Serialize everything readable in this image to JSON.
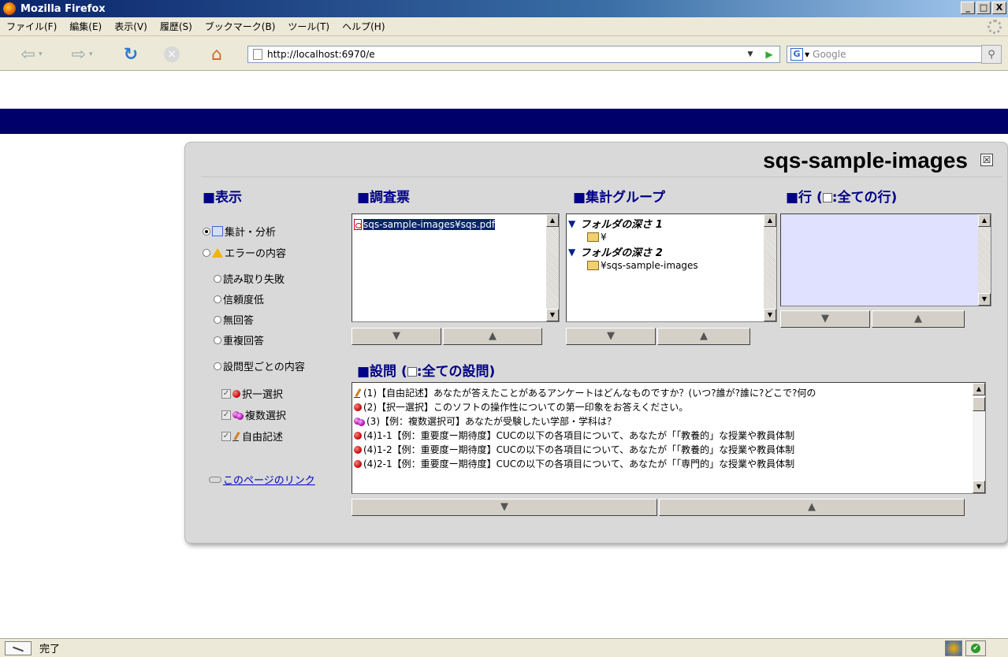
{
  "window": {
    "title": "Mozilla Firefox",
    "buttons": [
      "_",
      "□",
      "X"
    ]
  },
  "menu": [
    "ファイル(F)",
    "編集(E)",
    "表示(V)",
    "履歴(S)",
    "ブックマーク(B)",
    "ツール(T)",
    "ヘルプ(H)"
  ],
  "toolbar": {
    "url": "http://localhost:6970/e",
    "search_placeholder": "Google",
    "search_engine_letter": "G"
  },
  "panel": {
    "title": "sqs-sample-images",
    "close_label": "☒",
    "display": {
      "heading": "■表示",
      "options": {
        "aggregate": "集計・分析",
        "errors": "エラーの内容",
        "read_fail": "読み取り失敗",
        "low_conf": "信頼度低",
        "no_answer": "無回答",
        "dup_answer": "重複回答",
        "by_type": "設問型ごとの内容",
        "single": "択一選択",
        "multi": "複数選択",
        "free": "自由記述",
        "check_mark": "✓"
      },
      "link_text": "このページのリンク"
    },
    "survey": {
      "heading": "■調査票",
      "items": [
        "sqs-sample-images¥sqs.pdf"
      ]
    },
    "groups": {
      "heading": "■集計グループ",
      "depth1": "フォルダの深さ 1",
      "depth1_item": "¥",
      "depth2": "フォルダの深さ 2",
      "depth2_item": "¥sqs-sample-images",
      "triangle": "▼"
    },
    "rows": {
      "heading_prefix": "■行 (",
      "heading_suffix": ":全ての行)"
    },
    "questions": {
      "heading_prefix": "■設問 (",
      "heading_suffix": ":全ての設問)",
      "items": [
        {
          "type": "free",
          "text": "(1)【自由記述】あなたが答えたことがあるアンケートはどんなものですか？(いつ?誰が?誰に?どこで?何の"
        },
        {
          "type": "single",
          "text": "(2)【択一選択】このソフトの操作性についての第一印象をお答えください。"
        },
        {
          "type": "multi",
          "text": "(3)【例：複数選択可】あなたが受験したい学部・学科は？"
        },
        {
          "type": "single",
          "text": "(4)1-1【例：重要度ー期待度】CUCの以下の各項目について、あなたが「「教養的」な授業や教員体制"
        },
        {
          "type": "single",
          "text": "(4)1-2【例：重要度ー期待度】CUCの以下の各項目について、あなたが「「教養的」な授業や教員体制"
        },
        {
          "type": "single",
          "text": "(4)2-1【例：重要度ー期待度】CUCの以下の各項目について、あなたが「「専門的」な授業や教員体制"
        }
      ]
    },
    "arrows": {
      "down": "▼",
      "up": "▲",
      "scroll_up": "▲",
      "scroll_down": "▼"
    }
  },
  "status": {
    "text": "完了",
    "ok_mark": "✔"
  }
}
